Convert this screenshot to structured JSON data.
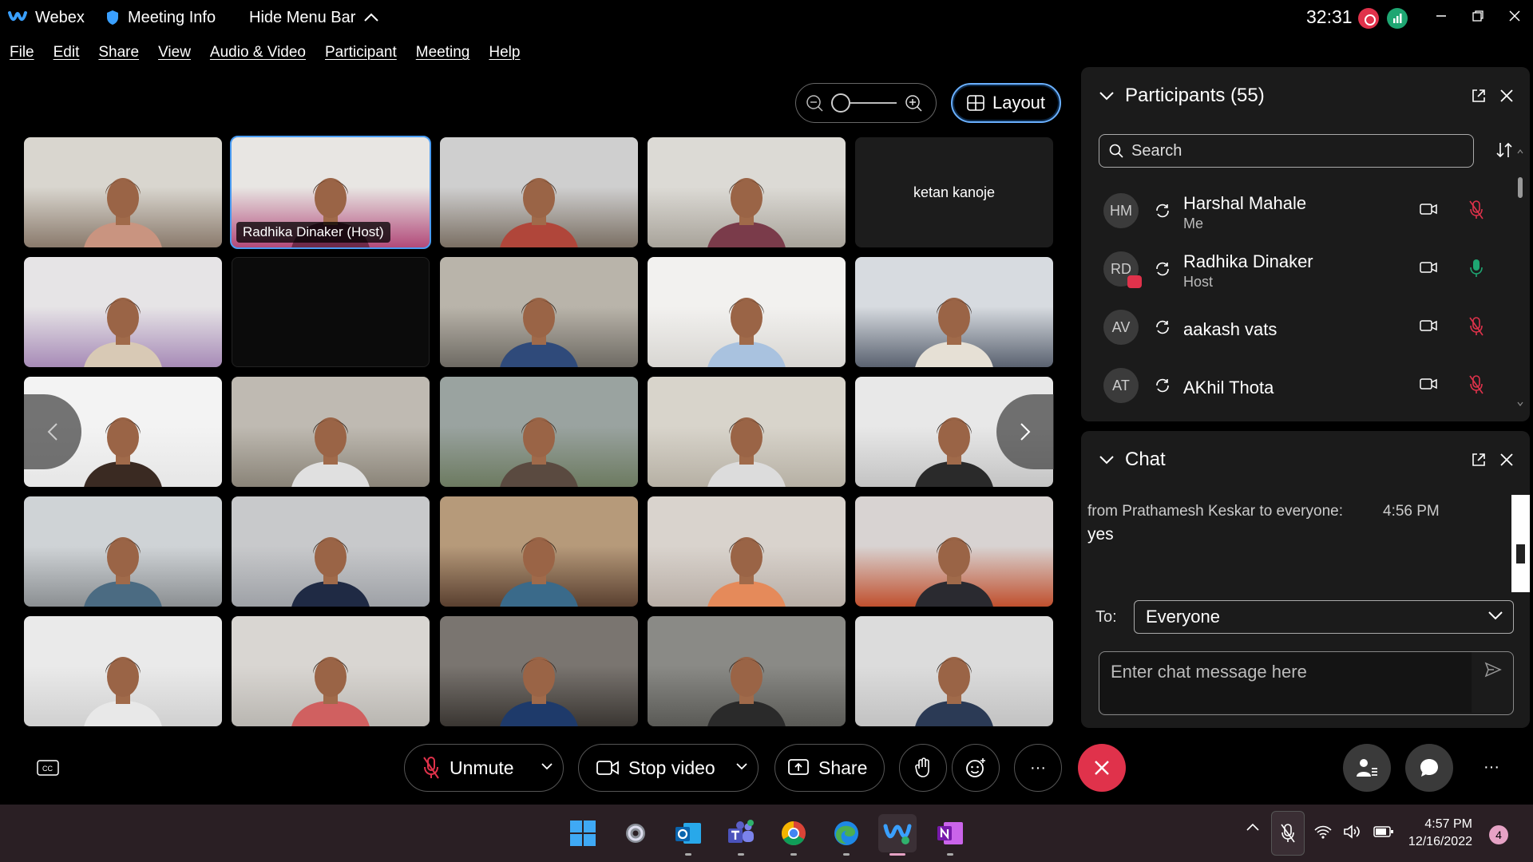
{
  "titlebar": {
    "app_name": "Webex",
    "meeting_info": "Meeting Info",
    "hide_menu": "Hide Menu Bar",
    "timer": "32:31"
  },
  "menu": [
    "File",
    "Edit",
    "Share",
    "View",
    "Audio & Video",
    "Participant",
    "Meeting",
    "Help"
  ],
  "toolbar": {
    "layout_label": "Layout",
    "zoom_level": 0
  },
  "grid": {
    "host_tag": "Radhika Dinaker (Host)",
    "no_video_name": "ketan kanoje"
  },
  "participants": {
    "title": "Participants (55)",
    "search_placeholder": "Search",
    "list": [
      {
        "initials": "HM",
        "name": "Harshal Mahale",
        "role": "Me",
        "mic": "muted"
      },
      {
        "initials": "RD",
        "name": "Radhika Dinaker",
        "role": "Host",
        "mic": "active"
      },
      {
        "initials": "AV",
        "name": "aakash vats",
        "role": "",
        "mic": "muted"
      },
      {
        "initials": "AT",
        "name": "AKhil Thota",
        "role": "",
        "mic": "muted"
      }
    ]
  },
  "chat": {
    "title": "Chat",
    "message": {
      "from": "from Prathamesh Keskar to everyone:",
      "time": "4:56 PM",
      "text": "yes"
    },
    "to_label": "To:",
    "to_value": "Everyone",
    "input_placeholder": "Enter chat message here"
  },
  "controls": {
    "unmute": "Unmute",
    "stop_video": "Stop video",
    "share": "Share",
    "more": "···"
  },
  "taskbar": {
    "time": "4:57 PM",
    "date": "12/16/2022",
    "notifications": "4"
  },
  "colors": {
    "accent": "#4a9cf2",
    "end_call": "#e0324b",
    "mic_muted": "#e0324b",
    "mic_active": "#1ea672",
    "panel_bg": "#1b1b1b",
    "taskbar_bg": "#2a1f24"
  }
}
